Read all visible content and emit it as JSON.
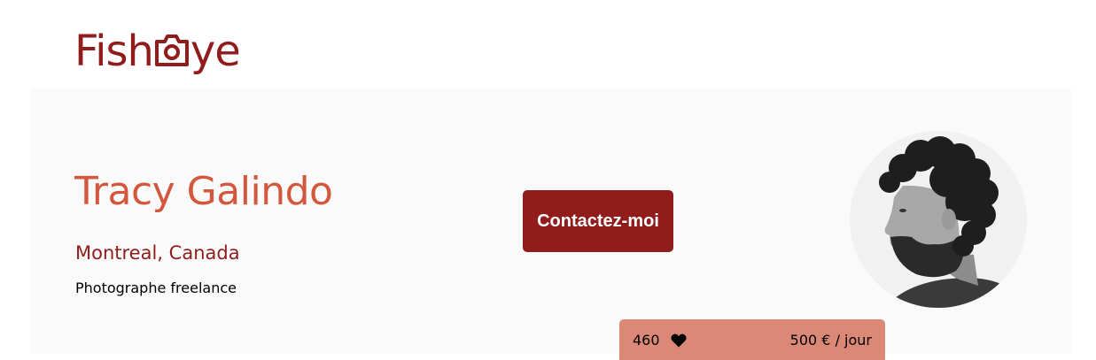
{
  "header": {
    "logo": {
      "text_before": "Fish",
      "text_after": "ye",
      "icon": "camera-icon",
      "color": "#901c1c"
    }
  },
  "profile": {
    "name": "Tracy Galindo",
    "location": "Montreal, Canada",
    "tagline": "Photographe freelance",
    "contact_label": "Contactez-moi",
    "portrait_icon": "photographer-portrait",
    "colors": {
      "name": "#d3573c",
      "location": "#901c1c",
      "button_bg": "#901c1c",
      "banner_bg": "#fafafa"
    }
  },
  "stats": {
    "likes": "460",
    "like_icon": "heart-icon",
    "rate": "500 € / jour",
    "background": "#db8876"
  }
}
